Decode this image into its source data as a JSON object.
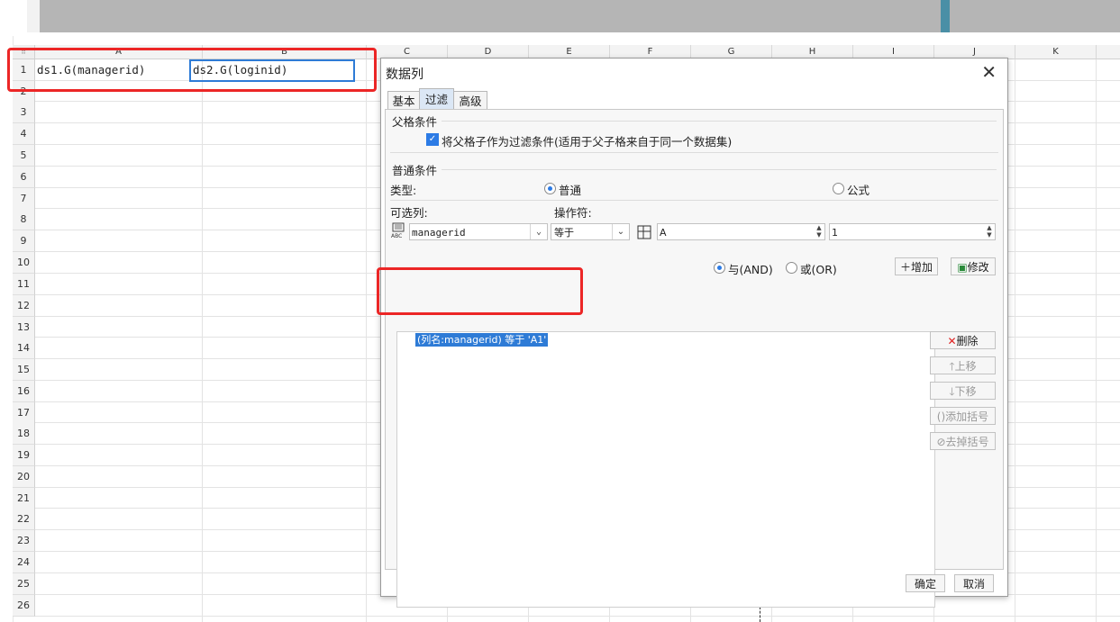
{
  "sheet": {
    "columns": [
      "A",
      "B",
      "C",
      "D",
      "E",
      "F",
      "G",
      "H",
      "I",
      "J",
      "K"
    ],
    "rows": [
      "1",
      "2",
      "3",
      "4",
      "5",
      "6",
      "7",
      "8",
      "9",
      "10",
      "11",
      "12",
      "13",
      "14",
      "15",
      "16",
      "17",
      "18",
      "19",
      "20",
      "21",
      "22",
      "23",
      "24",
      "25",
      "26"
    ],
    "cells": {
      "A1": "ds1.G(managerid)",
      "B1": "ds2.G(loginid)"
    }
  },
  "dialog": {
    "title": "数据列",
    "tabs": [
      "基本",
      "过滤",
      "高级"
    ],
    "active_tab": "过滤",
    "parent_section_title": "父格条件",
    "parent_checkbox_label": "将父格子作为过滤条件(适用于父子格来自于同一个数据集)",
    "parent_checkbox_checked": true,
    "common_section_title": "普通条件",
    "type_label": "类型:",
    "type_normal": "普通",
    "type_formula": "公式",
    "type_selected": "普通",
    "column_label": "可选列:",
    "operator_label": "操作符:",
    "column_value": "managerid",
    "operator_value": "等于",
    "value_input": "A",
    "value_input2": "1",
    "and_label": "与(AND)",
    "or_label": "或(OR)",
    "logic_selected": "and",
    "add_button": "增加",
    "modify_button": "修改",
    "delete_button": "删除",
    "move_up_button": "上移",
    "move_down_button": "下移",
    "add_bracket_button": "添加括号",
    "remove_bracket_button": "去掉括号",
    "conditions": [
      "(列名:managerid) 等于 'A1'"
    ],
    "ok_button": "确定",
    "cancel_button": "取消"
  },
  "colors": {
    "accent": "#2e7bd6",
    "highlight_box": "#ec2626"
  }
}
